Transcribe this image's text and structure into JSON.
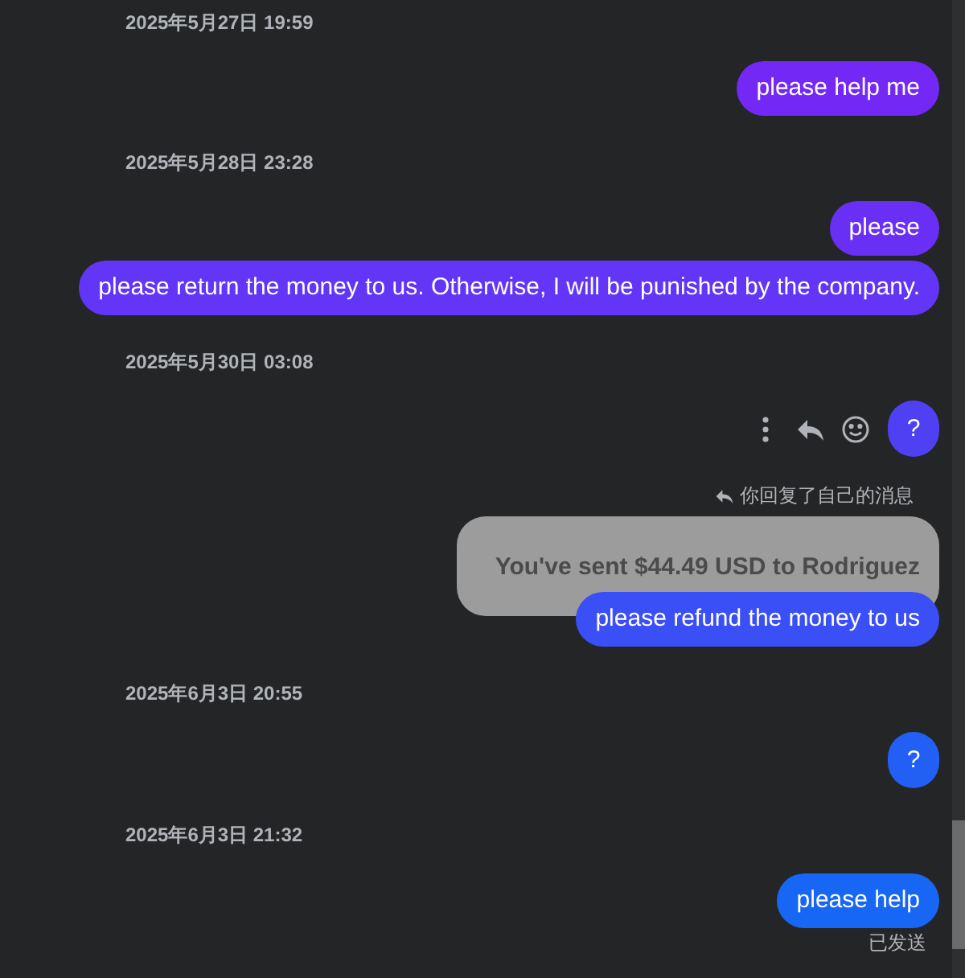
{
  "messages": [
    {
      "kind": "timestamp",
      "text": "2025年5月27日 19:59"
    },
    {
      "kind": "message",
      "text": "please help me",
      "color": "#7328f5"
    },
    {
      "kind": "timestamp",
      "text": "2025年5月28日 23:28"
    },
    {
      "kind": "message",
      "text": "please",
      "color": "#6a2ff5"
    },
    {
      "kind": "message",
      "text": "please return the money to us. Otherwise, I will be punished by the company.",
      "color": "#6235f7"
    },
    {
      "kind": "timestamp",
      "text": "2025年5月30日 03:08"
    },
    {
      "kind": "hovered_message",
      "text": "?",
      "color": "#4f40f3"
    },
    {
      "kind": "reply",
      "header": "你回复了自己的消息",
      "quoted": "You've sent $44.49 USD to Rodriguez",
      "text": "please refund the money to us",
      "color": "#3a4ff5"
    },
    {
      "kind": "timestamp",
      "text": "2025年6月3日 20:55"
    },
    {
      "kind": "message",
      "text": "?",
      "color": "#2260f5"
    },
    {
      "kind": "timestamp",
      "text": "2025年6月3日 21:32"
    },
    {
      "kind": "message",
      "text": "please help",
      "color": "#1766f4",
      "status": "已发送"
    }
  ]
}
